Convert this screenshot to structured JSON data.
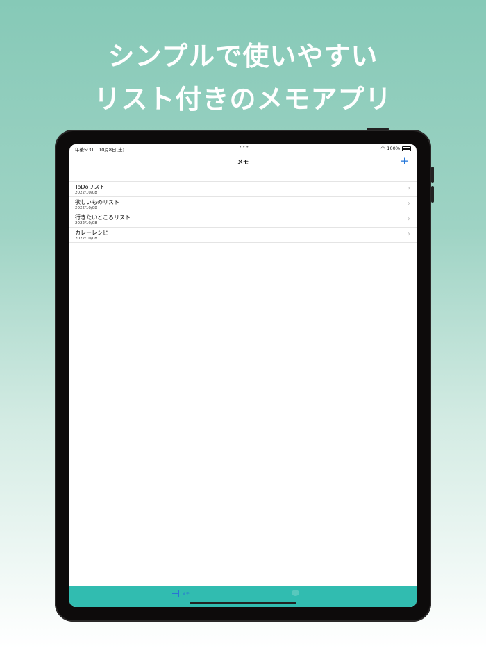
{
  "headline": {
    "line1": "シンプルで使いやすい",
    "line2": "リスト付きのメモアプリ"
  },
  "status_bar": {
    "time": "午後5:31　10月8日(土)",
    "battery": "100%",
    "wifi_icon": "wifi-icon",
    "battery_icon": "battery-icon"
  },
  "nav": {
    "title": "メモ",
    "add_label": "+"
  },
  "memos": [
    {
      "title": "ToDoリスト",
      "date": "2022/10/08"
    },
    {
      "title": "欲しいものリスト",
      "date": "2022/10/08"
    },
    {
      "title": "行きたいところリスト",
      "date": "2022/10/08"
    },
    {
      "title": "カレーレシピ",
      "date": "2022/10/08"
    }
  ],
  "tabs": [
    {
      "label": "メモ",
      "icon": "memo-icon",
      "selected": true
    },
    {
      "label": "",
      "icon": "chat-icon",
      "selected": false
    }
  ],
  "colors": {
    "accent": "#1f73d9",
    "tab_bar": "#31bcb0",
    "background_top": "#86c9b7"
  }
}
